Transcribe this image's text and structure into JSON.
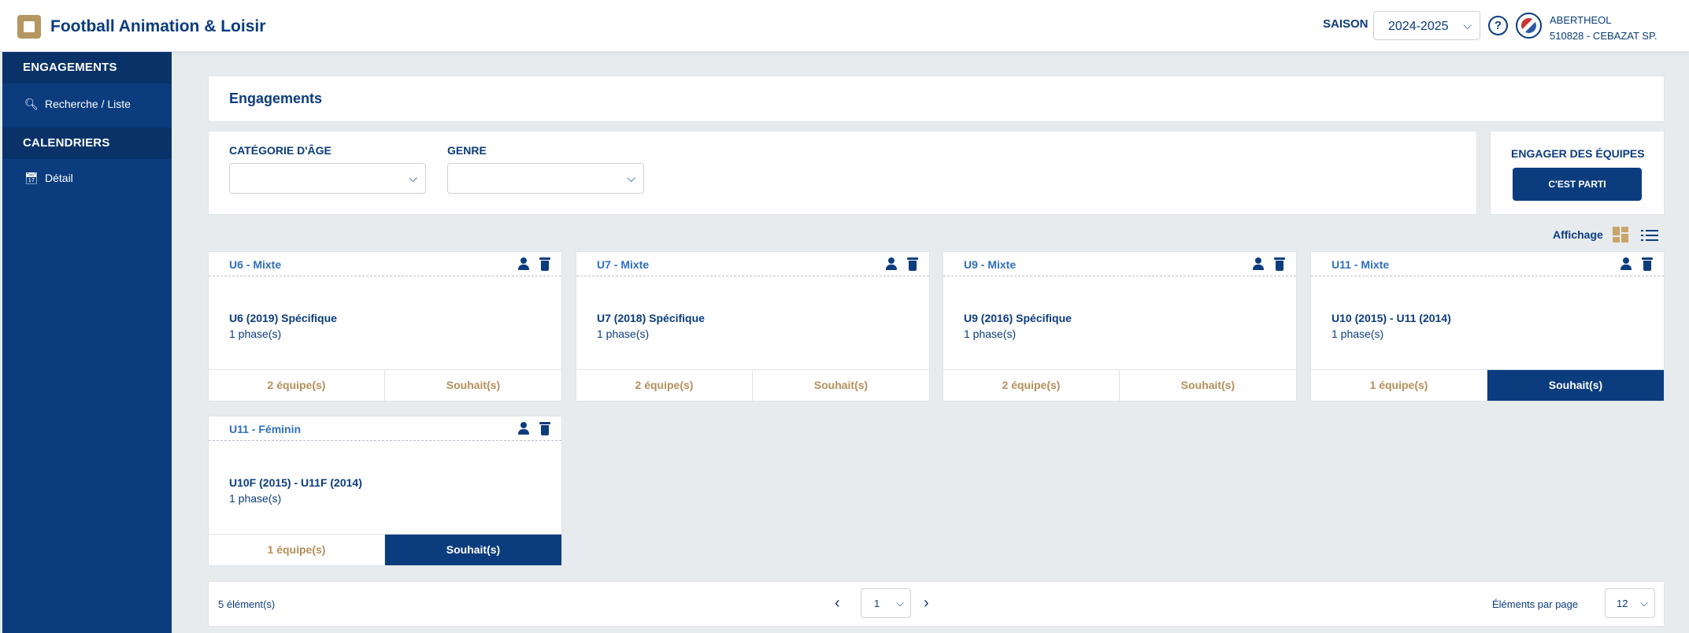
{
  "header": {
    "app_title": "Football Animation & Loisir",
    "season_label": "SAISON",
    "season_value": "2024-2025",
    "help_glyph": "?",
    "user_name": "ABERTHEOL",
    "user_club": "510828 - CEBAZAT SP."
  },
  "sidebar": {
    "sections": [
      {
        "title": "ENGAGEMENTS",
        "item": {
          "label": "Recherche / Liste",
          "icon": "search-icon"
        }
      },
      {
        "title": "CALENDRIERS",
        "item": {
          "label": "Détail",
          "icon": "calendar-icon"
        }
      }
    ]
  },
  "main": {
    "page_title": "Engagements",
    "filters": {
      "age_label": "CATÉGORIE D'ÂGE",
      "age_value": "",
      "gender_label": "GENRE",
      "gender_value": ""
    },
    "engage": {
      "title": "ENGAGER DES ÉQUIPES",
      "button": "C'EST PARTI"
    },
    "display_label": "Affichage",
    "cards": [
      {
        "name": "U6 - Mixte",
        "category": "U6 (2019) Spécifique",
        "phases": "1 phase(s)",
        "teams": "2 équipe(s)",
        "wishes": "Souhait(s)",
        "wishes_active": false
      },
      {
        "name": "U7 - Mixte",
        "category": "U7 (2018) Spécifique",
        "phases": "1 phase(s)",
        "teams": "2 équipe(s)",
        "wishes": "Souhait(s)",
        "wishes_active": false
      },
      {
        "name": "U9 - Mixte",
        "category": "U9 (2016) Spécifique",
        "phases": "1 phase(s)",
        "teams": "2 équipe(s)",
        "wishes": "Souhait(s)",
        "wishes_active": false
      },
      {
        "name": "U11 - Mixte",
        "category": "U10 (2015) - U11 (2014)",
        "phases": "1 phase(s)",
        "teams": "1 équipe(s)",
        "wishes": "Souhait(s)",
        "wishes_active": true
      },
      {
        "name": "U11 - Féminin",
        "category": "U10F (2015) - U11F (2014)",
        "phases": "1 phase(s)",
        "teams": "1 équipe(s)",
        "wishes": "Souhait(s)",
        "wishes_active": true
      }
    ],
    "pagination": {
      "count": "5 élément(s)",
      "page": "1",
      "per_page_label": "Éléments par page",
      "per_page": "12"
    }
  },
  "colors": {
    "primary": "#0b3c7e",
    "accent": "#b58f5a",
    "link": "#2f6fbf",
    "background": "#e8ebee"
  }
}
